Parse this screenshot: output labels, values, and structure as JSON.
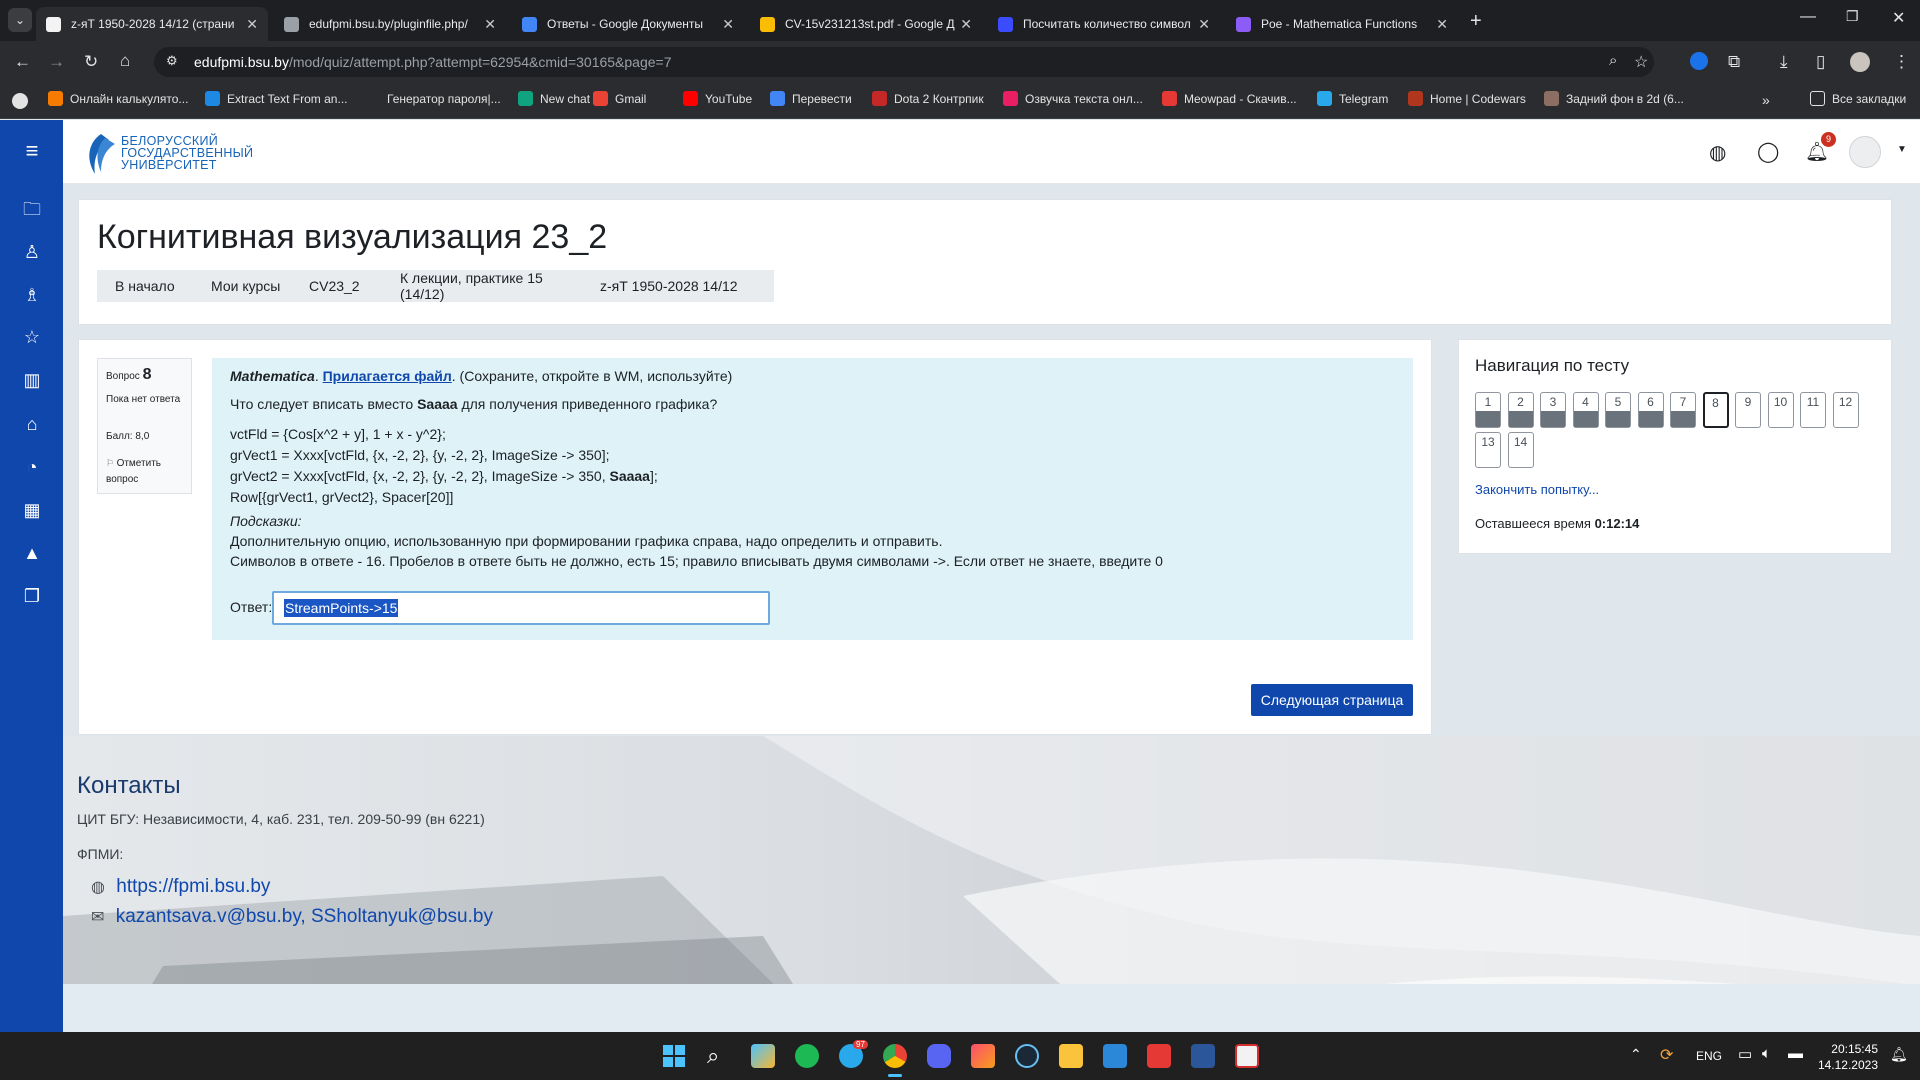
{
  "browser": {
    "tabs": [
      {
        "title": "z-яТ 1950-2028 14/12 (страни",
        "color": "#f3f3f3"
      },
      {
        "title": "edufpmi.bsu.by/pluginfile.php/",
        "color": "#9aa0a6"
      },
      {
        "title": "Ответы - Google Документы",
        "color": "#4285f4"
      },
      {
        "title": "CV-15v231213st.pdf - Google Д",
        "color": "#fbbc04"
      },
      {
        "title": "Посчитать количество символ",
        "color": "#3b4cff"
      },
      {
        "title": "Poe - Mathematica Functions",
        "color": "#8b5cf6"
      }
    ],
    "url_host": "edufpmi.bsu.by",
    "url_path": "/mod/quiz/attempt.php?attempt=62954&cmid=30165&page=7",
    "bookmarks": [
      {
        "label": "Онлайн калькулято...",
        "color": "#f57c00"
      },
      {
        "label": "Extract Text From an...",
        "color": "#1e88e5"
      },
      {
        "label": "Генератор пароля|...",
        "color": "#2b2c2f"
      },
      {
        "label": "New chat",
        "color": "#10a37f"
      },
      {
        "label": "Gmail",
        "color": "#ea4335"
      },
      {
        "label": "YouTube",
        "color": "#ff0000"
      },
      {
        "label": "Перевести",
        "color": "#4285f4"
      },
      {
        "label": "Dota 2 Контрпик",
        "color": "#c62828"
      },
      {
        "label": "Озвучка текста онл...",
        "color": "#e91e63"
      },
      {
        "label": "Meowpad - Скачив...",
        "color": "#e53935"
      },
      {
        "label": "Telegram",
        "color": "#29a9eb"
      },
      {
        "label": "Home | Codewars",
        "color": "#b1361e"
      },
      {
        "label": "Задний фон в 2d (6...",
        "color": "#8d6e63"
      }
    ],
    "all_bookmarks": "Все закладки"
  },
  "site": {
    "logo_line1": "БЕЛОРУССКИЙ",
    "logo_line2": "ГОСУДАРСТВЕННЫЙ",
    "logo_line3": "УНИВЕРСИТЕТ",
    "notif_count": "9"
  },
  "course": {
    "title": "Когнитивная визуализация 23_2",
    "breadcrumbs": [
      "В начало",
      "Мои курсы",
      "CV23_2",
      "К лекции, практике 15 (14/12)",
      "z-яТ 1950-2028 14/12"
    ]
  },
  "question": {
    "label": "Вопрос",
    "number": "8",
    "status": "Пока нет ответа",
    "points": "Балл: 8,0",
    "flag": "Отметить вопрос",
    "intro_italic": "Mathematica",
    "intro_link": "Прилагается файл",
    "intro_rest": ". (Сохраните, откройте в WM, используйте)",
    "prompt_a": "Что следует вписать вместо ",
    "prompt_bold": "Saaaa",
    "prompt_b": " для получения приведенного графика?",
    "code1": "vctFld = {Cos[x^2 + y], 1 + x - y^2};",
    "code2": "grVect1 = Xxxx[vctFld, {x, -2, 2}, {y, -2, 2}, ImageSize -> 350];",
    "code3a": "grVect2 = Xxxx[vctFld, {x, -2, 2}, {y, -2, 2}, ImageSize -> 350, ",
    "code3b": "Saaaa",
    "code3c": "];",
    "code4": "Row[{grVect1, grVect2}, Spacer[20]]",
    "hints_label": "Подсказки",
    "hint1": "Дополнительную опцию, использованную при формировании графика справа, надо определить и отправить.",
    "hint2": "Символов в ответе - 16. Пробелов в ответе быть не должно, есть 15; правило вписывать двумя символами ->. Если ответ не знаете, введите 0",
    "answer_label": "Ответ:",
    "answer_value": "StreamPoints->15",
    "next_button": "Следующая страница"
  },
  "quiz_nav": {
    "title": "Навигация по тесту",
    "buttons": [
      "1",
      "2",
      "3",
      "4",
      "5",
      "6",
      "7",
      "8",
      "9",
      "10",
      "11",
      "12",
      "13",
      "14"
    ],
    "finish_link": "Закончить попытку...",
    "time_label": "Оставшееся время ",
    "time_value": "0:12:14"
  },
  "footer": {
    "contacts_title": "Контакты",
    "address": "ЦИТ БГУ: Независимости, 4, каб. 231, тел. 209-50-99 (вн 6221)",
    "dept": "ФПМИ:",
    "site_link": "https://fpmi.bsu.by",
    "emails": "kazantsava.v@bsu.by, SSholtanyuk@bsu.by"
  },
  "taskbar": {
    "lang": "ENG",
    "time": "20:15:45",
    "date": "14.12.2023",
    "telegram_badge": "97"
  }
}
